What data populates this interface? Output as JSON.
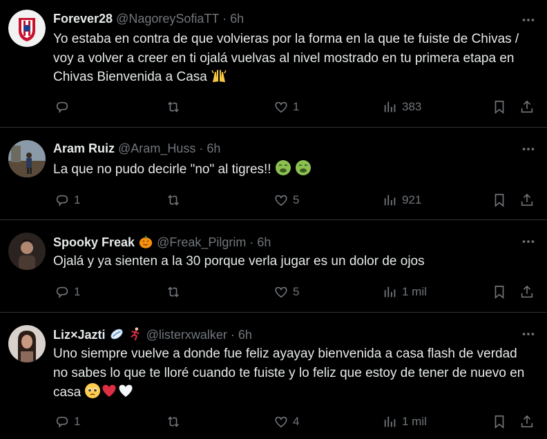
{
  "replies": [
    {
      "name": "Forever28",
      "handle": "@NagoreySofiaTT",
      "time": "· 6h",
      "text": "Yo estaba en contra de que volvieras por la forma en la que te fuiste de Chivas / voy a volver a creer en ti ojalá vuelvas al nivel mostrado en tu primera etapa en Chivas Bienvenida a Casa",
      "emojis": [
        "raised-hands"
      ],
      "replies": "",
      "reposts": "",
      "likes": "1",
      "views": "383"
    },
    {
      "name": "Aram Ruiz",
      "handle": "@Aram_Huss",
      "time": "· 6h",
      "text": "La que no pudo decirle \"no\" al tigres!!",
      "emojis": [
        "nauseated-face",
        "nauseated-face"
      ],
      "replies": "1",
      "reposts": "",
      "likes": "5",
      "views": "921"
    },
    {
      "name": "Spooky Freak",
      "handle": "@Freak_Pilgrim",
      "time": "· 6h",
      "text": "Ojalá y ya sienten a la 30 porque verla jugar es un dolor de ojos",
      "emojis": [],
      "replies": "1",
      "reposts": "",
      "likes": "5",
      "views": "1 mil"
    },
    {
      "name": "Liz×Jazti",
      "handle": "@listerxwalker",
      "time": "· 6h",
      "text": "Uno siempre vuelve a donde fue feliz ayayay bienvenida a casa flash de verdad no sabes lo que te lloré cuando te fuiste y lo feliz que estoy de tener de nuevo en casa",
      "emojis": [
        "pleading-face",
        "red-heart",
        "white-heart"
      ],
      "replies": "1",
      "reposts": "",
      "likes": "4",
      "views": "1 mil"
    }
  ],
  "colors": {
    "background": "#000000",
    "text": "#e7e9ea",
    "muted": "#71767b",
    "divider": "#2f3336"
  },
  "icons": [
    "more-icon",
    "reply-icon",
    "repost-icon",
    "like-icon",
    "views-icon",
    "bookmark-icon",
    "share-icon"
  ]
}
